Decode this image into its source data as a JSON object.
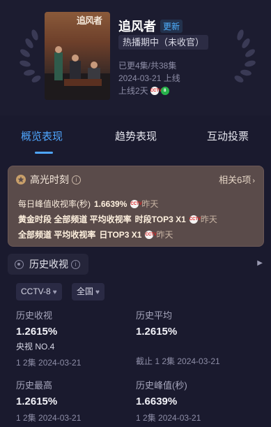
{
  "show": {
    "title": "追风者",
    "update_badge": "更新",
    "status": "热播期中（未收官）",
    "episodes": "已更4集/共38集",
    "air_date": "2024-03-21 上线",
    "days_online": "上线2天",
    "poster_title": "追风者"
  },
  "tabs": [
    "概览表现",
    "趋势表现",
    "互动投票"
  ],
  "highlight": {
    "title": "高光时刻",
    "more": "相关6项",
    "rows": [
      {
        "prefix": "每日峰值收视率(秒)",
        "value": "1.6639%",
        "ago": "昨天"
      },
      {
        "prefix": "黄金时段 全部频道 平均收视率",
        "value": "时段TOP3 X1",
        "ago": "昨天"
      },
      {
        "prefix": "全部频道 平均收视率",
        "value": "日TOP3 X1",
        "ago": "昨天"
      }
    ]
  },
  "history": {
    "title": "历史收视",
    "filters": [
      "CCTV-8",
      "全国"
    ],
    "stats": [
      {
        "label": "历史收视",
        "value": "1.2615%",
        "sub": "央视 NO.4",
        "foot": "1 2集 2024-03-21"
      },
      {
        "label": "历史平均",
        "value": "1.2615%",
        "sub": "",
        "foot": "截止 1 2集 2024-03-21"
      },
      {
        "label": "历史最高",
        "value": "1.2615%",
        "sub": "",
        "foot": "1 2集 2024-03-21"
      },
      {
        "label": "历史峰值(秒)",
        "value": "1.6639%",
        "sub": "",
        "foot": "1 2集 2024-03-21"
      }
    ]
  },
  "channel_badges": [
    "CCTV",
    "8"
  ],
  "colors": {
    "accent": "#4fa6ff",
    "highlight_bg": "#5a4b4a",
    "page_bg": "#1a1a2e"
  },
  "icons": [
    "laurel-left-icon",
    "laurel-right-icon",
    "medal-icon",
    "info-icon",
    "gear-icon",
    "chevron-right-icon",
    "heart-icon"
  ]
}
